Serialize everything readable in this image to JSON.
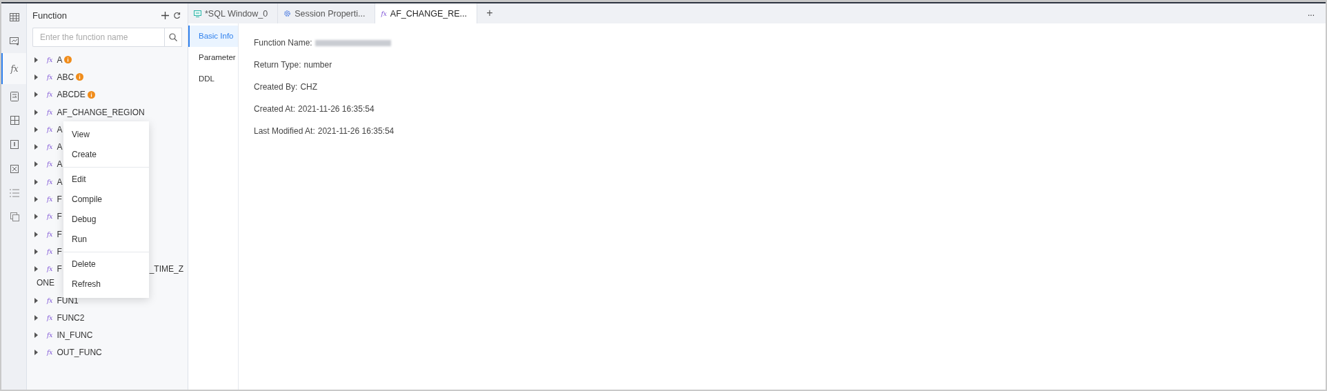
{
  "rail": [
    {
      "kind": "table",
      "selected": false
    },
    {
      "kind": "view",
      "selected": false
    },
    {
      "kind": "function",
      "glyph": "fx",
      "selected": true
    },
    {
      "kind": "procedure",
      "selected": false
    },
    {
      "kind": "grid",
      "selected": false
    },
    {
      "kind": "package",
      "selected": false
    },
    {
      "kind": "trigger",
      "selected": false
    },
    {
      "kind": "list",
      "selected": false
    },
    {
      "kind": "copy",
      "selected": false
    }
  ],
  "panel": {
    "title": "Function",
    "search": {
      "placeholder": "Enter the function name"
    }
  },
  "tree": [
    {
      "icon": "fx",
      "label": "A",
      "warning": true
    },
    {
      "icon": "fx",
      "label": "ABC",
      "warning": true
    },
    {
      "icon": "fx",
      "label": "ABCDE",
      "warning": true
    },
    {
      "icon": "fx",
      "label": "AF_CHANGE_REGION",
      "warning": false
    },
    {
      "icon": "fx",
      "label": "A",
      "warning": false
    },
    {
      "icon": "fx",
      "label": "A",
      "warning": false
    },
    {
      "icon": "fx",
      "label": "A",
      "warning": false
    },
    {
      "icon": "fx",
      "label": "A",
      "warning": false
    },
    {
      "icon": "fx",
      "label": "F",
      "warning": false
    },
    {
      "icon": "fx",
      "label": "F",
      "warning": false
    },
    {
      "icon": "fx",
      "label": "F",
      "warning": false
    },
    {
      "icon": "fx",
      "label": "F",
      "warning": false
    },
    {
      "icon": "fx",
      "label": "F",
      "tail": "_TIME_Z",
      "continuation": "ONE",
      "warning": false
    },
    {
      "icon": "fx",
      "label": "FUN1",
      "warning": false
    },
    {
      "icon": "fx",
      "label": "FUNC2",
      "warning": false
    },
    {
      "icon": "fx",
      "label": "IN_FUNC",
      "warning": false
    },
    {
      "icon": "fx",
      "label": "OUT_FUNC",
      "warning": false
    }
  ],
  "context_menu": [
    [
      {
        "label": "View"
      },
      {
        "label": "Create"
      }
    ],
    [
      {
        "label": "Edit"
      },
      {
        "label": "Compile"
      },
      {
        "label": "Debug"
      },
      {
        "label": "Run"
      }
    ],
    [
      {
        "label": "Delete"
      },
      {
        "label": "Refresh"
      }
    ]
  ],
  "tabs": [
    {
      "label": "*SQL Window_0",
      "kind": "sql",
      "selected": false
    },
    {
      "label": "Session Properti...",
      "kind": "settings",
      "selected": false
    },
    {
      "label": "AF_CHANGE_RE...",
      "kind": "function",
      "glyph": "fx",
      "selected": true
    }
  ],
  "new_tab": "+",
  "more": "...",
  "subnav": [
    {
      "label": "Basic Info",
      "selected": true
    },
    {
      "label": "Parameter",
      "selected": false
    },
    {
      "label": "DDL",
      "selected": false
    }
  ],
  "details": [
    {
      "label": "Function Name:",
      "redacted": true
    },
    {
      "label": "Return Type:",
      "value": "number",
      "redacted": false
    },
    {
      "label": "Created By:",
      "value": "CHZ",
      "redacted": false
    },
    {
      "label": "Created At:",
      "value": "2021-11-26 16:35:54",
      "redacted": false
    },
    {
      "label": "Last Modified At:",
      "value": "2021-11-26 16:35:54",
      "redacted": false
    }
  ]
}
